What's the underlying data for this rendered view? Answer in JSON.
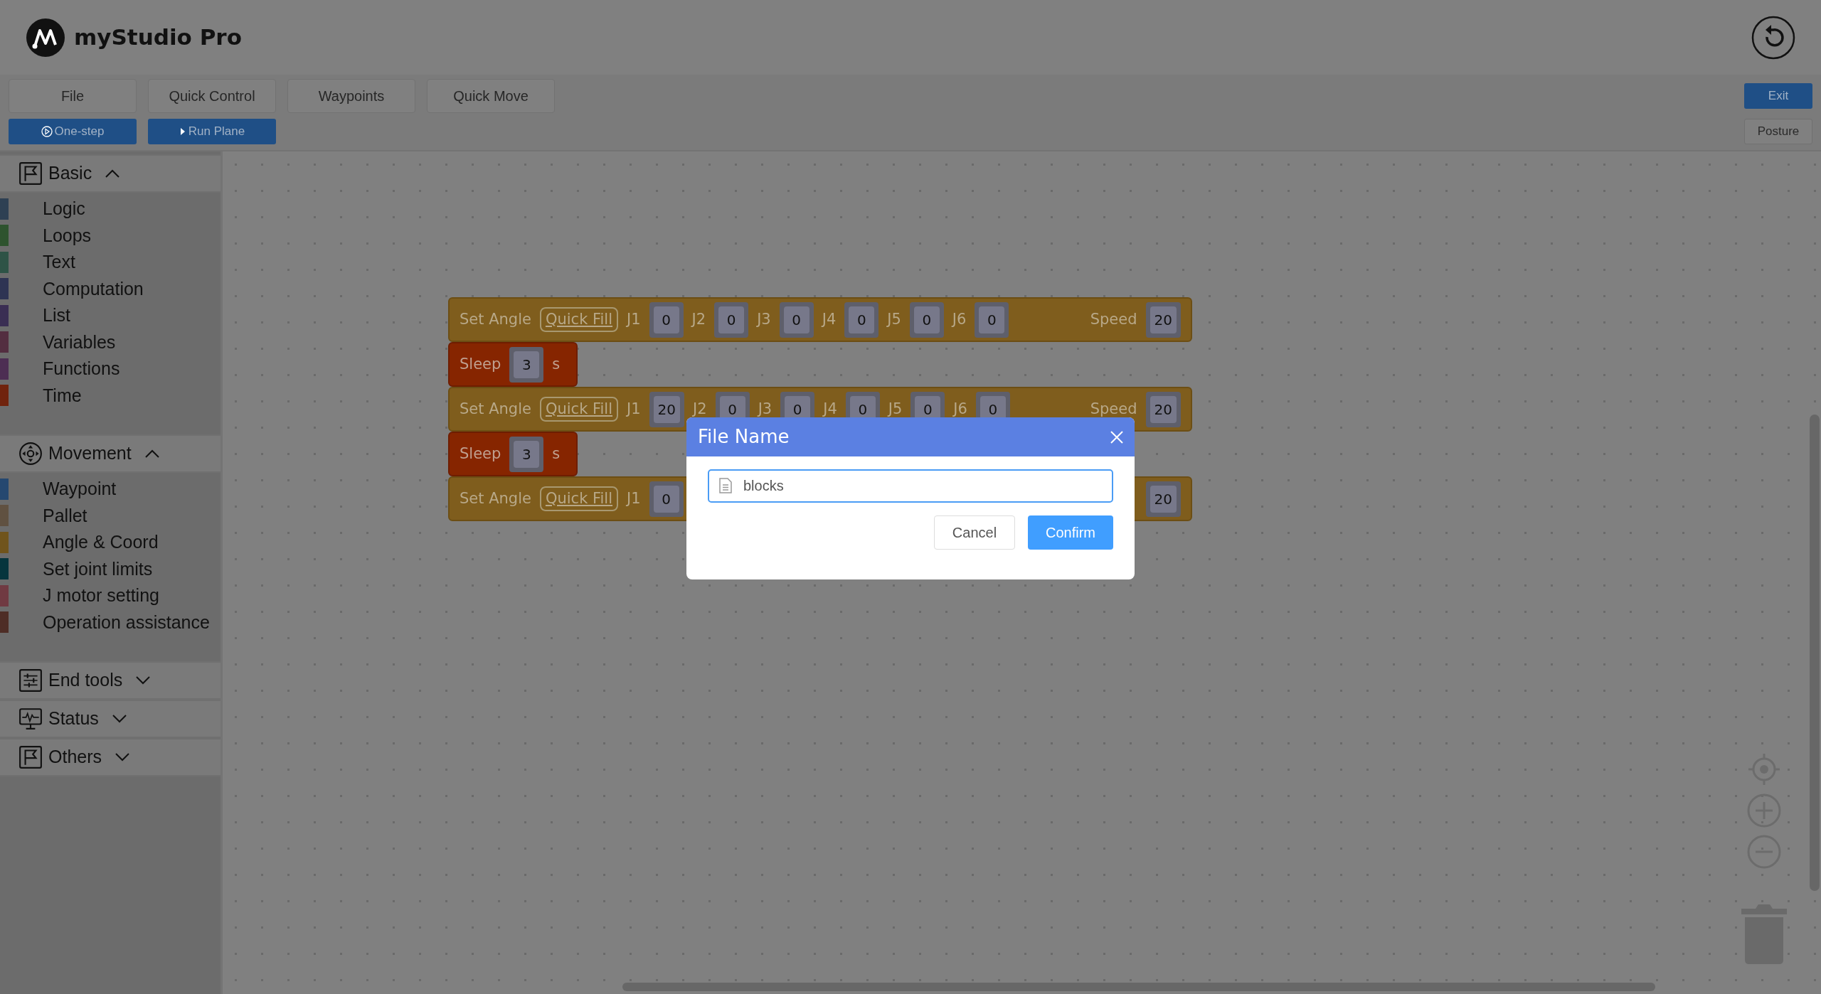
{
  "app": {
    "title": "myStudio Pro"
  },
  "menu": [
    {
      "label": "File"
    },
    {
      "label": "Quick Control"
    },
    {
      "label": "Waypoints"
    },
    {
      "label": "Quick Move"
    }
  ],
  "exit_button": "Exit",
  "run_buttons": [
    {
      "kind": "step",
      "label": "One-step"
    },
    {
      "kind": "run",
      "label": "Run Plane"
    }
  ],
  "posture_button": "Posture",
  "sidebar": [
    {
      "title": "Basic",
      "expanded": true,
      "items": [
        {
          "label": "Logic",
          "color": "#2e4053"
        },
        {
          "label": "Loops",
          "color": "#2e532e"
        },
        {
          "label": "Text",
          "color": "#2e5346"
        },
        {
          "label": "Computation",
          "color": "#2e3453"
        },
        {
          "label": "List",
          "color": "#3a2e53"
        },
        {
          "label": "Variables",
          "color": "#532e40"
        },
        {
          "label": "Functions",
          "color": "#4d2e53"
        },
        {
          "label": "Time",
          "color": "#70230d"
        }
      ]
    },
    {
      "title": "Movement",
      "expanded": true,
      "items": [
        {
          "label": "Waypoint",
          "color": "#254870"
        },
        {
          "label": "Pallet",
          "color": "#605141"
        },
        {
          "label": "Angle & Coord",
          "color": "#70541c"
        },
        {
          "label": "Set joint limits",
          "color": "#06353d"
        },
        {
          "label": "J motor setting",
          "color": "#703a42"
        },
        {
          "label": "Operation assistance",
          "color": "#4e2d26"
        }
      ]
    },
    {
      "title": "End tools",
      "expanded": false
    },
    {
      "title": "Status",
      "expanded": false
    },
    {
      "title": "Others",
      "expanded": false
    }
  ],
  "blocks": [
    {
      "kind": "set_angle",
      "title": "Set Angle",
      "button": "Quick Fill",
      "joints": [
        {
          "label": "J1",
          "value": "0"
        },
        {
          "label": "J2",
          "value": "0"
        },
        {
          "label": "J3",
          "value": "0"
        },
        {
          "label": "J4",
          "value": "0"
        },
        {
          "label": "J5",
          "value": "0"
        },
        {
          "label": "J6",
          "value": "0"
        }
      ],
      "speed_label": "Speed",
      "speed_value": "20"
    },
    {
      "kind": "sleep",
      "title": "Sleep",
      "value": "3",
      "unit": "s"
    },
    {
      "kind": "set_angle",
      "title": "Set Angle",
      "button": "Quick Fill",
      "joints": [
        {
          "label": "J1",
          "value": "20"
        },
        {
          "label": "J2",
          "value": "0"
        },
        {
          "label": "J3",
          "value": "0"
        },
        {
          "label": "J4",
          "value": "0"
        },
        {
          "label": "J5",
          "value": "0"
        },
        {
          "label": "J6",
          "value": "0"
        }
      ],
      "speed_label": "Speed",
      "speed_value": "20"
    },
    {
      "kind": "sleep",
      "title": "Sleep",
      "value": "3",
      "unit": "s"
    },
    {
      "kind": "set_angle",
      "title": "Set Angle",
      "button": "Quick Fill",
      "joints": [
        {
          "label": "J1",
          "value": "0"
        }
      ],
      "speed_value": "20"
    }
  ],
  "dialog": {
    "title": "File Name",
    "value": "blocks",
    "cancel": "Cancel",
    "confirm": "Confirm"
  }
}
